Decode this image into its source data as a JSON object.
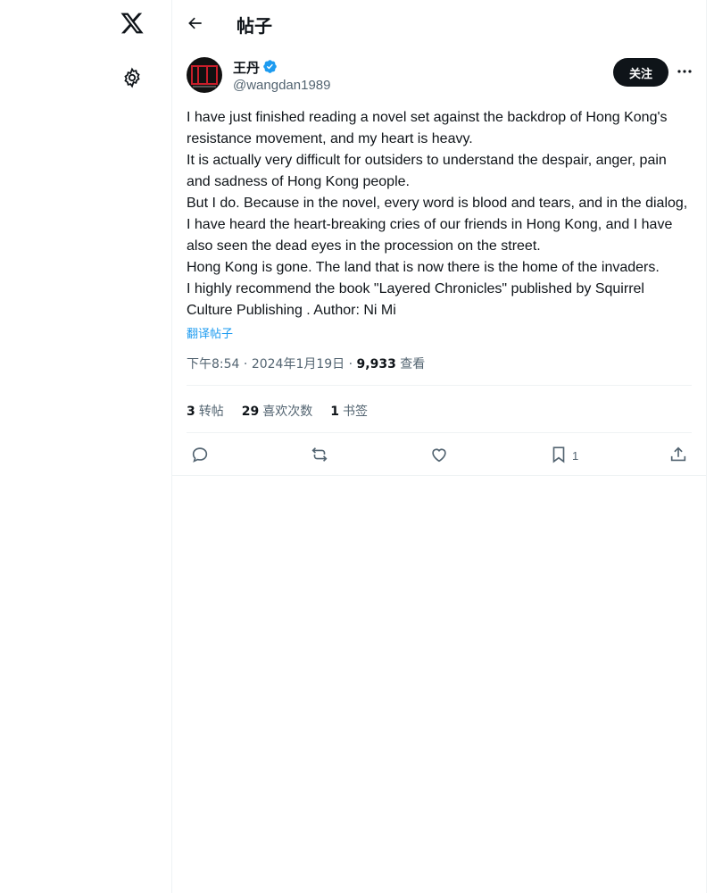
{
  "header": {
    "title": "帖子"
  },
  "author": {
    "name": "王丹",
    "handle": "@wangdan1989",
    "follow_label": "关注"
  },
  "post": {
    "paragraphs": [
      "I have just finished reading a novel set against the backdrop of Hong Kong's resistance movement, and my heart is heavy.",
      "It is actually very difficult for outsiders to understand the despair, anger, pain and sadness of Hong Kong people.",
      "But I do. Because in the novel, every word is blood and tears, and in the dialog, I have heard the heart-breaking cries of our friends in Hong Kong, and I have also seen the dead eyes in the procession on the street.",
      "Hong Kong is gone. The land that is now there is the home of the invaders.",
      "I highly recommend the book \"Layered Chronicles\" published by Squirrel Culture Publishing . Author: Ni Mi"
    ],
    "translate_label": "翻译帖子",
    "time": "下午8:54",
    "date": "2024年1月19日",
    "views_count": "9,933",
    "views_label": "查看",
    "sep": "·"
  },
  "stats": {
    "reposts_count": "3",
    "reposts_label": "转帖",
    "likes_count": "29",
    "likes_label": "喜欢次数",
    "bookmarks_count": "1",
    "bookmarks_label": "书签"
  },
  "actions": {
    "bookmark_count": "1"
  },
  "icons": {
    "logo": "x-logo-icon",
    "settings": "gear-icon",
    "back": "back-arrow-icon",
    "verified": "verified-badge-icon",
    "more": "more-icon",
    "reply": "reply-icon",
    "repost": "repost-icon",
    "like": "heart-icon",
    "bookmark": "bookmark-icon",
    "share": "share-icon"
  },
  "colors": {
    "accent": "#1d9bf0",
    "text": "#0f1419",
    "muted": "#536471",
    "border": "#eff3f4"
  }
}
